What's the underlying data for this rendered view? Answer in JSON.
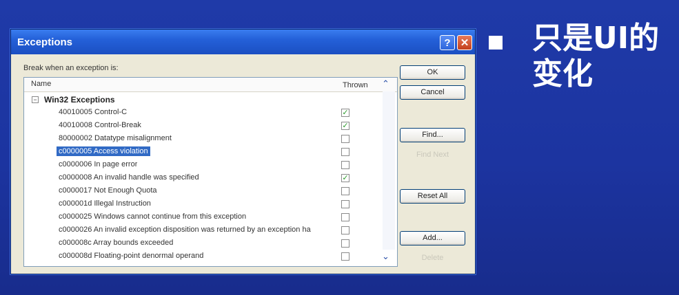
{
  "slide": {
    "text_line1": "只是UI的",
    "text_line2": "变化"
  },
  "dialog": {
    "title": "Exceptions",
    "help_glyph": "?",
    "close_glyph": "✕",
    "break_label": "Break when an exception is:",
    "columns": {
      "name": "Name",
      "thrown": "Thrown"
    },
    "group_label": "Win32 Exceptions",
    "rows": [
      {
        "text": "40010005 Control-C",
        "thrown": true
      },
      {
        "text": "40010008 Control-Break",
        "thrown": true
      },
      {
        "text": "80000002 Datatype misalignment",
        "thrown": false
      },
      {
        "text": "c0000005 Access violation",
        "thrown": false,
        "selected": true
      },
      {
        "text": "c0000006 In page error",
        "thrown": false
      },
      {
        "text": "c0000008 An invalid handle was specified",
        "thrown": true
      },
      {
        "text": "c0000017 Not Enough Quota",
        "thrown": false
      },
      {
        "text": "c000001d Illegal Instruction",
        "thrown": false
      },
      {
        "text": "c0000025 Windows cannot continue from this exception",
        "thrown": false
      },
      {
        "text": "c0000026 An invalid exception disposition was returned by an exception ha",
        "thrown": false
      },
      {
        "text": "c000008c Array bounds exceeded",
        "thrown": false
      },
      {
        "text": "c000008d Floating-point denormal operand",
        "thrown": false
      }
    ],
    "buttons": {
      "ok": "OK",
      "cancel": "Cancel",
      "find": "Find...",
      "find_next": "Find Next",
      "reset_all": "Reset All",
      "add": "Add...",
      "delete": "Delete"
    }
  }
}
